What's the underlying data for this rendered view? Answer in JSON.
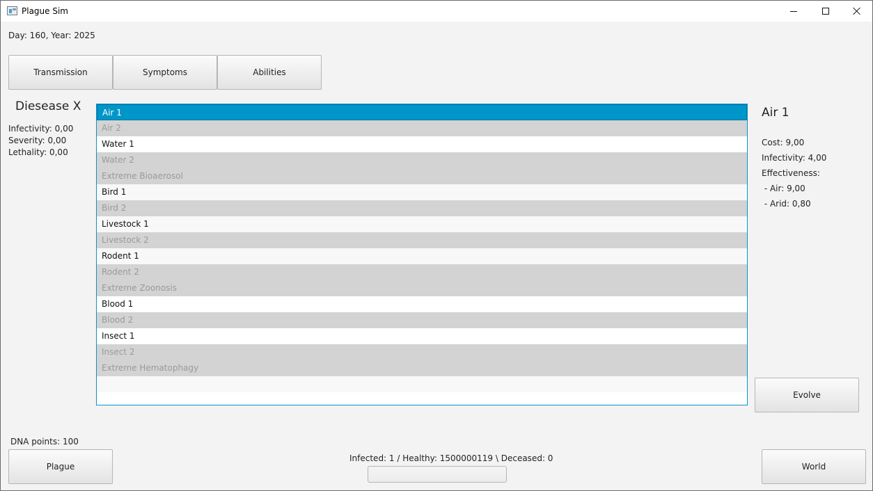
{
  "window": {
    "title": "Plague Sim"
  },
  "date_text": "Day: 160, Year: 2025",
  "tabs": [
    {
      "label": "Transmission"
    },
    {
      "label": "Symptoms"
    },
    {
      "label": "Abilities"
    }
  ],
  "disease": {
    "name": "Diesease X",
    "infectivity": "Infectivity: 0,00",
    "severity": "Severity: 0,00",
    "lethality": "Lethality: 0,00"
  },
  "list": {
    "items": [
      {
        "label": "Air 1",
        "state": "selected"
      },
      {
        "label": "Air 2",
        "state": "disabled"
      },
      {
        "label": "Water 1",
        "state": "enabled"
      },
      {
        "label": "Water 2",
        "state": "disabled"
      },
      {
        "label": "Extreme Bioaerosol",
        "state": "disabled"
      },
      {
        "label": "Bird 1",
        "state": "enabled"
      },
      {
        "label": "Bird 2",
        "state": "disabled"
      },
      {
        "label": "Livestock 1",
        "state": "enabled"
      },
      {
        "label": "Livestock 2",
        "state": "disabled"
      },
      {
        "label": "Rodent 1",
        "state": "enabled"
      },
      {
        "label": "Rodent 2",
        "state": "disabled"
      },
      {
        "label": "Extreme Zoonosis",
        "state": "disabled"
      },
      {
        "label": "Blood 1",
        "state": "enabled"
      },
      {
        "label": "Blood 2",
        "state": "disabled"
      },
      {
        "label": "Insect 1",
        "state": "enabled"
      },
      {
        "label": "Insect 2",
        "state": "disabled"
      },
      {
        "label": "Extreme Hematophagy",
        "state": "disabled"
      }
    ]
  },
  "detail": {
    "title": "Air 1",
    "cost": "Cost: 9,00",
    "infectivity": "Infectivity: 4,00",
    "effectiveness_label": "Effectiveness:",
    "effect_air": " - Air: 9,00",
    "effect_arid": " - Arid: 0,80"
  },
  "evolve_label": "Evolve",
  "dna_points": "DNA points: 100",
  "plague_label": "Plague",
  "world_label": "World",
  "population_text": "Infected: 1 / Healthy: 1500000119 \\ Deceased: 0",
  "infection_progress": 0.0,
  "colors": {
    "accent": "#0096c9",
    "disabled_row": "#d3d3d3"
  }
}
